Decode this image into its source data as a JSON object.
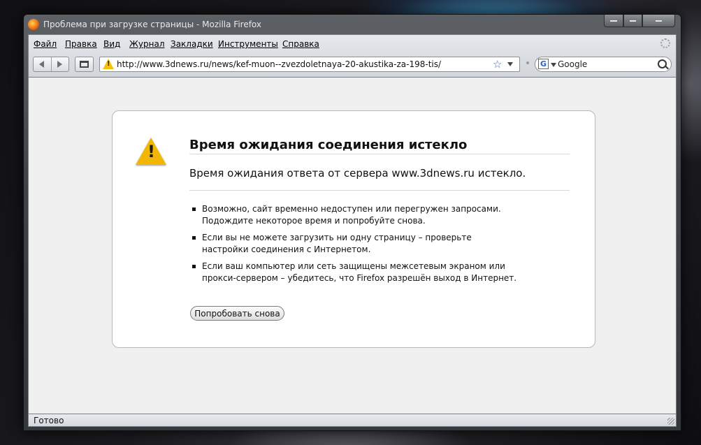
{
  "window": {
    "title": "Проблема при загрузке страницы - Mozilla Firefox"
  },
  "menubar": {
    "items": [
      "Файл",
      "Правка",
      "Вид",
      "Журнал",
      "Закладки",
      "Инструменты",
      "Справка"
    ]
  },
  "navbar": {
    "url": "http://www.3dnews.ru/news/kef-muon--zvezdoletnaya-20-akustika-za-198-tis/",
    "search_engine_icon": "G",
    "search_placeholder": "Google"
  },
  "error_page": {
    "title": "Время ожидания соединения истекло",
    "description": "Время ожидания ответа от сервера www.3dnews.ru истекло.",
    "suggestions": [
      "Возможно, сайт временно недоступен или перегружен запросами. Подождите некоторое время и попробуйте снова.",
      "Если вы не можете загрузить ни одну страницу – проверьте настройки соединения с Интернетом.",
      "Если ваш компьютер или сеть защищены межсетевым экраном или прокси-сервером – убедитесь, что Firefox разрешён выход в Интернет."
    ],
    "try_again_label": "Попробовать снова"
  },
  "statusbar": {
    "text": "Готово"
  },
  "icons": {
    "url_status": "warning-icon",
    "bookmark": "star-icon",
    "error": "warning-icon",
    "search": "magnifier-icon"
  },
  "colors": {
    "warning": "#f2b705",
    "content_bg": "#f0f0f0"
  }
}
